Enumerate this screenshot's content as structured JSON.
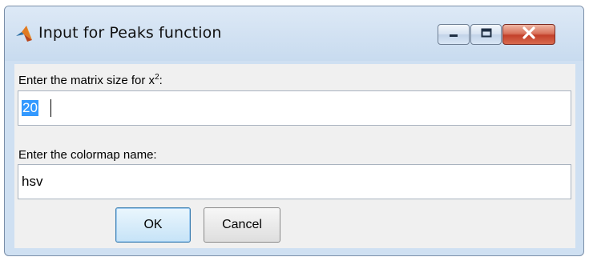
{
  "window": {
    "title": "Input for Peaks function",
    "app_icon": "matlab-membrane-icon",
    "controls": {
      "minimize_icon": "minimize-icon",
      "maximize_icon": "maximize-icon",
      "close_icon": "close-icon"
    }
  },
  "form": {
    "fields": [
      {
        "label_main": "Enter the matrix size for x",
        "label_sup": "2",
        "label_suffix": ":",
        "value": "20",
        "selected": true
      },
      {
        "label_main": "Enter the colormap name:",
        "value": "hsv",
        "selected": false
      }
    ]
  },
  "buttons": {
    "ok_label": "OK",
    "cancel_label": "Cancel"
  },
  "colors": {
    "title_bar": "#cfe0f2",
    "content_bg": "#f0f0f0",
    "close_button": "#c3412b",
    "selection": "#3399ff"
  }
}
